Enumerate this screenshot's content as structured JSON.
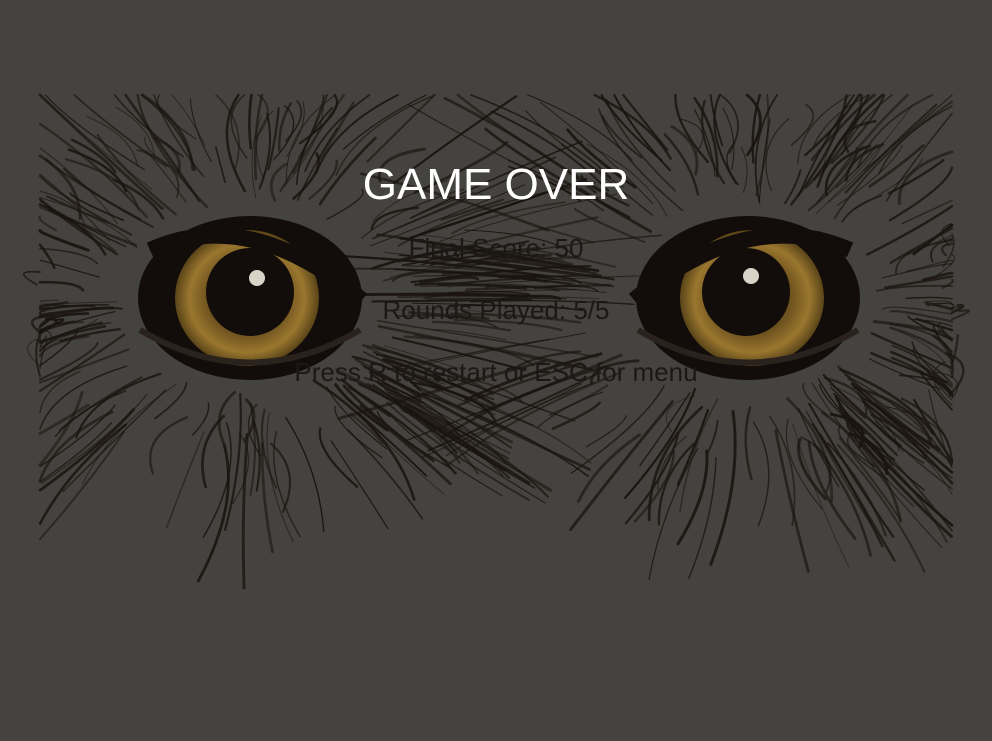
{
  "screen": {
    "title": "GAME OVER",
    "final_score_label": "Final Score: 50",
    "rounds_played_label": "Rounds Played: 5/5",
    "instructions": "Press R to restart or ESC for menu"
  },
  "stats": {
    "final_score": 50,
    "rounds_played": 5,
    "rounds_total": 5
  },
  "controls": {
    "restart_key": "R",
    "menu_key": "ESC"
  },
  "colors": {
    "background": "#45433f",
    "title": "#ffffff",
    "body_text": "#1b1815",
    "feather_ink": "#1a1410",
    "iris_gold": "#8a6a2a",
    "pupil": "#120d0a",
    "eye_highlight": "#d9d4c8"
  },
  "artwork": {
    "subject": "owl-eyes-illustration"
  }
}
